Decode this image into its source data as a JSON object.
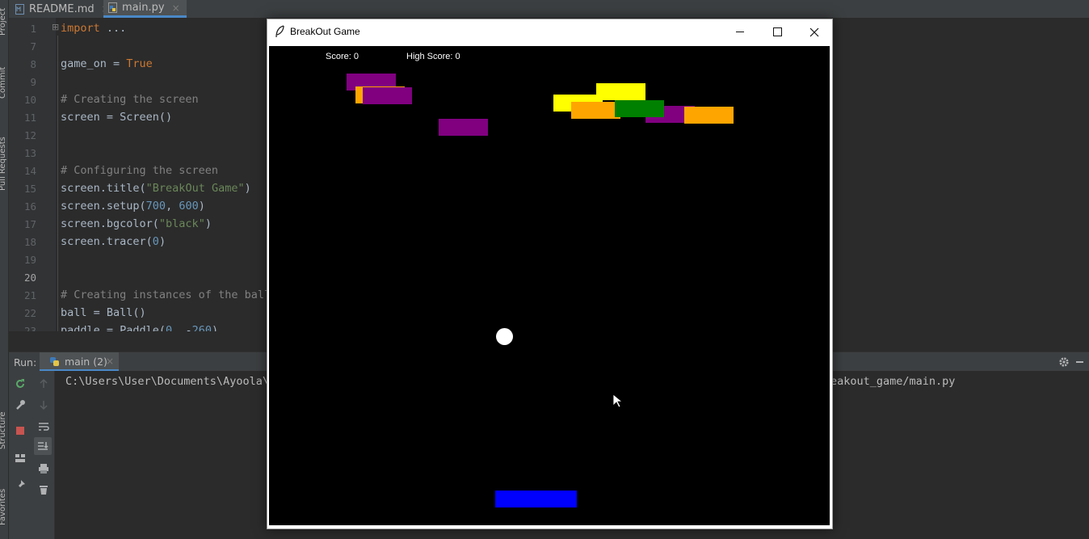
{
  "tabs": [
    {
      "label": "README.md",
      "close": "×"
    },
    {
      "label": "main.py",
      "close": "×"
    }
  ],
  "side_tools": [
    "Project",
    "Commit",
    "Pull Requests",
    "Structure",
    "Favorites"
  ],
  "editor": {
    "line_numbers": [
      "1",
      "7",
      "8",
      "9",
      "10",
      "11",
      "12",
      "13",
      "14",
      "15",
      "16",
      "17",
      "18",
      "19",
      "20",
      "21",
      "22",
      "23"
    ],
    "fold_marker": "⊞"
  },
  "run": {
    "label": "Run:",
    "tab_label": "main (2)",
    "tab_close": "×",
    "console_left": "C:\\Users\\User\\Documents\\Ayoola\\",
    "console_right": "eakout_game/main.py"
  },
  "game": {
    "title": "BreakOut Game",
    "score": "Score: 0",
    "high_score": "High Score: 0",
    "colors": {
      "purple": "#800080",
      "orange": "#ffa500",
      "yellow": "#ffff00",
      "green": "#008000",
      "paddle": "#0000ff",
      "ball": "#ffffff",
      "background": "#000000"
    }
  },
  "icons": [
    "python-file-icon",
    "markdown-file-icon",
    "feather-icon",
    "minimize-icon",
    "maximize-icon",
    "close-icon",
    "gear-icon",
    "check-icon",
    "rerun-icon",
    "stop-icon",
    "wrench-icon",
    "pin-icon",
    "print-icon",
    "trash-icon",
    "soft-wrap-icon",
    "scroll-end-icon",
    "layout-icon",
    "mouse-cursor-icon"
  ]
}
